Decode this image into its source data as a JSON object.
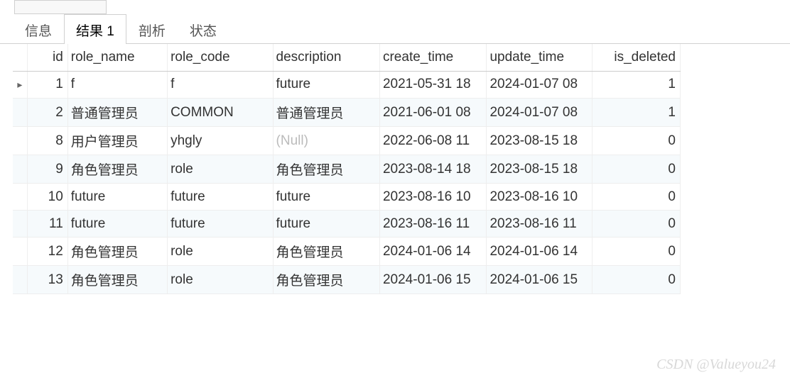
{
  "tabs": {
    "info": "信息",
    "result": "结果 1",
    "profile": "剖析",
    "status": "状态"
  },
  "table": {
    "headers": {
      "id": "id",
      "role_name": "role_name",
      "role_code": "role_code",
      "description": "description",
      "create_time": "create_time",
      "update_time": "update_time",
      "is_deleted": "is_deleted"
    },
    "rows": [
      {
        "id": "1",
        "role_name": "f",
        "role_code": "f",
        "description": "future",
        "create_time": "2021-05-31 18",
        "update_time": "2024-01-07 08",
        "is_deleted": "1"
      },
      {
        "id": "2",
        "role_name": "普通管理员",
        "role_code": "COMMON",
        "description": "普通管理员",
        "create_time": "2021-06-01 08",
        "update_time": "2024-01-07 08",
        "is_deleted": "1"
      },
      {
        "id": "8",
        "role_name": "用户管理员",
        "role_code": "yhgly",
        "description": "(Null)",
        "create_time": "2022-06-08 11",
        "update_time": "2023-08-15 18",
        "is_deleted": "0",
        "desc_null": true
      },
      {
        "id": "9",
        "role_name": "角色管理员",
        "role_code": "role",
        "description": "角色管理员",
        "create_time": "2023-08-14 18",
        "update_time": "2023-08-15 18",
        "is_deleted": "0"
      },
      {
        "id": "10",
        "role_name": "future",
        "role_code": "future",
        "description": "future",
        "create_time": "2023-08-16 10",
        "update_time": "2023-08-16 10",
        "is_deleted": "0"
      },
      {
        "id": "11",
        "role_name": "future",
        "role_code": "future",
        "description": "future",
        "create_time": "2023-08-16 11",
        "update_time": "2023-08-16 11",
        "is_deleted": "0"
      },
      {
        "id": "12",
        "role_name": "角色管理员",
        "role_code": "role",
        "description": "角色管理员",
        "create_time": "2024-01-06 14",
        "update_time": "2024-01-06 14",
        "is_deleted": "0"
      },
      {
        "id": "13",
        "role_name": "角色管理员",
        "role_code": "role",
        "description": "角色管理员",
        "create_time": "2024-01-06 15",
        "update_time": "2024-01-06 15",
        "is_deleted": "0"
      }
    ]
  },
  "row_marker": "▸",
  "watermark": "CSDN @Valueyou24"
}
